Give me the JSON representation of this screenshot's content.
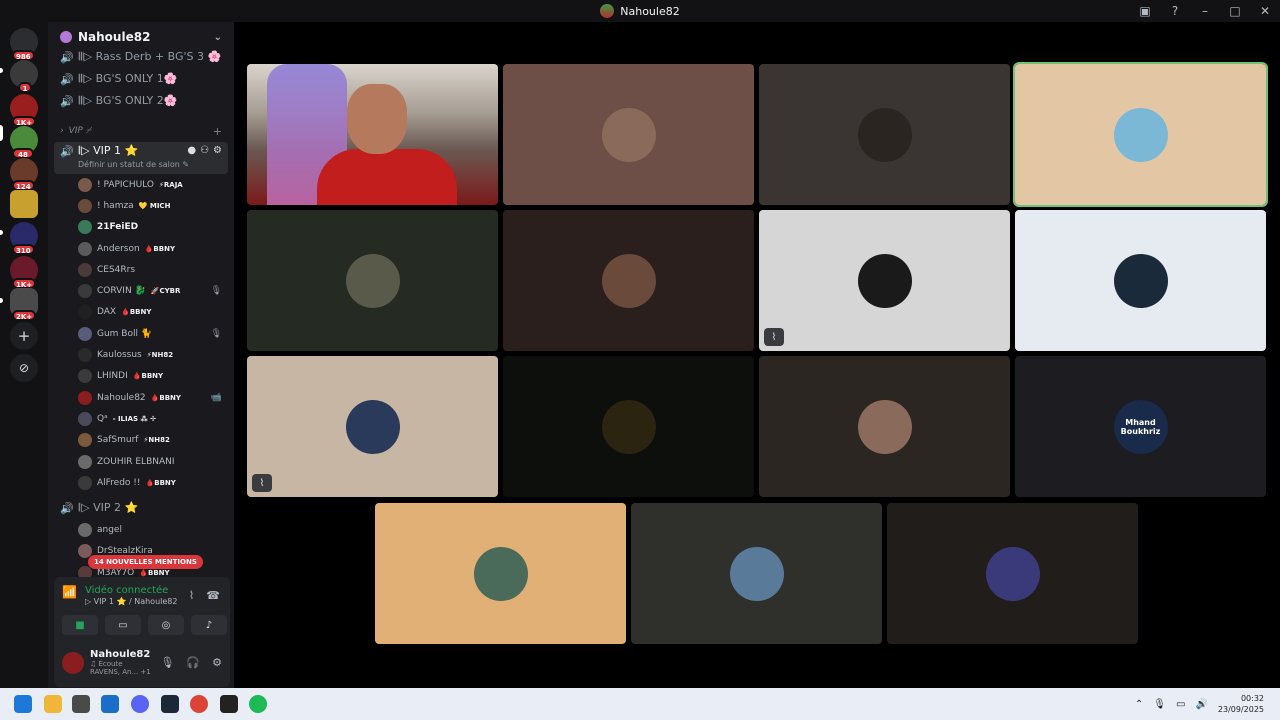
{
  "window": {
    "title": "Nahoule82"
  },
  "server_rail": {
    "badges": [
      "986",
      "1",
      "1K+",
      "48",
      "124",
      "310",
      "1K+",
      "2K+"
    ],
    "icons": [
      "discord-home-icon",
      "add-server-icon",
      "discover-icon"
    ]
  },
  "guild": {
    "name": "Nahoule82"
  },
  "channels": {
    "top": [
      "𝄃𝄃▷ Rass Derb + BG'S 3 🌸",
      "𝄃𝄃▷ BG'S ONLY 1🌸",
      "𝄃𝄃▷ BG'S ONLY 2🌸"
    ],
    "category": "VIP ⌿",
    "active": {
      "name": "𝄃▷ VIP 1 ⭐",
      "status": "Définir un statut de salon ✎"
    },
    "vip2": "𝄃▷ VIP 2 ⭐"
  },
  "members": [
    {
      "name": "! PAPICHULO",
      "tag": "⚡RAJA",
      "color": "#7a5a4a"
    },
    {
      "name": "! hamza",
      "tag": "💛 MICH",
      "color": "#6a4a3a"
    },
    {
      "name": "21FeiED",
      "tag": "",
      "color": "#3a7a5a",
      "bright": true
    },
    {
      "name": "Anderson",
      "tag": "🩸BBNY",
      "color": "#5a5a5a"
    },
    {
      "name": "CES4Rrs",
      "tag": "",
      "color": "#4a3a3a"
    },
    {
      "name": "CORVIN 🐉",
      "tag": "🚀CYBR",
      "color": "#3a3a3a",
      "status": "🎙"
    },
    {
      "name": "DAX",
      "tag": "🩸BBNY",
      "color": "#202020"
    },
    {
      "name": "Gum Boll 🐈",
      "tag": "",
      "color": "#5a5a7a",
      "status": "🎙"
    },
    {
      "name": "Kaulossus",
      "tag": "⚡NH82",
      "color": "#2a2a2a"
    },
    {
      "name": "LHINDI",
      "tag": "🩸BBNY",
      "color": "#3a3a3a"
    },
    {
      "name": "Nahoule82",
      "tag": "🩸BBNY",
      "color": "#8a1e1e",
      "status": "📹"
    },
    {
      "name": "Qᵃ",
      "tag": "- ILIAS ⁂ ✢",
      "color": "#4a4a5a"
    },
    {
      "name": "SafSmurf",
      "tag": "⚡NH82",
      "color": "#7a5a3a"
    },
    {
      "name": "ZOUHIR ELBNANI",
      "tag": "",
      "color": "#6a6a6a"
    },
    {
      "name": "AlFredo !!",
      "tag": "🩸BBNY",
      "color": "#3a3a3a"
    }
  ],
  "vip2_members": [
    {
      "name": "angel",
      "tag": "",
      "color": "#6a6a6a"
    },
    {
      "name": "DrStealzKira",
      "tag": "",
      "color": "#7a5a5a"
    },
    {
      "name": "M3AY7O",
      "tag": "🩸BBNY",
      "color": "#5a3a3a"
    }
  ],
  "mentions_banner": "14 NOUVELLES MENTIONS",
  "voice": {
    "status": "Vidéo connectée",
    "channel": "▷ VIP 1 ⭐ / Nahoule82",
    "buttons": [
      "camera-icon",
      "screen-share-icon",
      "activity-icon",
      "soundboard-icon"
    ]
  },
  "me": {
    "name": "Nahoule82",
    "activity": "♫ Écoute RAVENS, An...  +1"
  },
  "tiles": [
    {
      "bg": "#cam",
      "type": "camera"
    },
    {
      "bg": "#6e4f47",
      "av": "#8a6a5a"
    },
    {
      "bg": "#3a3532",
      "av": "#2a2520"
    },
    {
      "bg": "#e3c7a4",
      "av": "#7ab8d6",
      "speaking": true
    },
    {
      "bg": "#252a22",
      "av": "#5a5a4a"
    },
    {
      "bg": "#2a1f1c",
      "av": "#6a4a3a"
    },
    {
      "bg": "#d6d6d6",
      "av": "#1a1a1a",
      "muted": true
    },
    {
      "bg": "#e6ebf2",
      "av": "#1a2a3a"
    },
    {
      "bg": "#c8b6a4",
      "av": "#2a3a5a",
      "muted": true
    },
    {
      "bg": "#0d0f0d",
      "av": "#2a2410"
    },
    {
      "bg": "#2b2622",
      "av": "#8a6a5a"
    },
    {
      "bg": "#1d1c20",
      "av": "#1a2a4a",
      "label": "Mhand Boukhriz"
    },
    {
      "bg": "#e0b076",
      "av": "#4a6a5a"
    },
    {
      "bg": "#2f302b",
      "av": "#5a7a9a"
    },
    {
      "bg": "#211d1b",
      "av": "#3a3a7a"
    }
  ],
  "taskbar": {
    "apps": [
      "windows-start-icon",
      "file-explorer-icon",
      "store-icon",
      "outlook-icon",
      "discord-icon",
      "steam-icon",
      "chrome-icon",
      "app-icon",
      "spotify-icon"
    ],
    "time": "00:32",
    "date": "23/09/2025"
  }
}
